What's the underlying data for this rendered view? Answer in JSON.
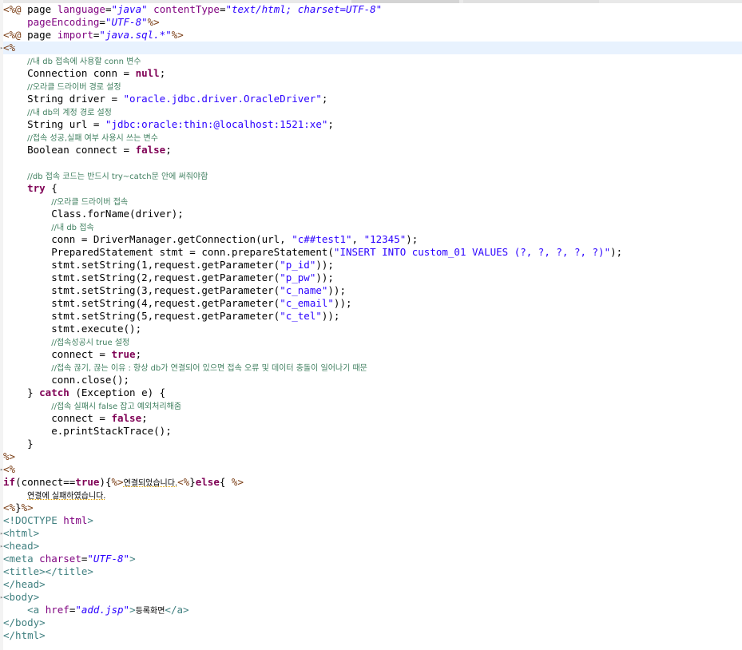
{
  "colors": {
    "background": "#ffffff",
    "current_line": "#e8f2fe",
    "directive": "#7a3d14",
    "keyword": "#7f0055",
    "string": "#2a00ff",
    "comment": "#3f7f5f",
    "tag": "#3f7f7f",
    "attribute": "#7f007f"
  },
  "editor": {
    "current_line_index": 3,
    "lines": [
      [
        [
          "dir",
          "<%@"
        ],
        [
          "t",
          " page "
        ],
        [
          "attr",
          "language"
        ],
        [
          "t",
          "="
        ],
        [
          "aval",
          "\"java\""
        ],
        [
          "t",
          " "
        ],
        [
          "attr",
          "contentType"
        ],
        [
          "t",
          "="
        ],
        [
          "aval",
          "\"text/html; charset=UTF-8\""
        ]
      ],
      [
        [
          "t",
          "    "
        ],
        [
          "attr",
          "pageEncoding"
        ],
        [
          "t",
          "="
        ],
        [
          "aval",
          "\"UTF-8\""
        ],
        [
          "dir",
          "%>"
        ]
      ],
      [
        [
          "dir",
          "<%@"
        ],
        [
          "t",
          " page "
        ],
        [
          "attr",
          "import"
        ],
        [
          "t",
          "="
        ],
        [
          "aval",
          "\"java.sql.*\""
        ],
        [
          "dir",
          "%>"
        ]
      ],
      [
        [
          "dir",
          "<%"
        ]
      ],
      [
        [
          "t",
          "    "
        ],
        [
          "com",
          "//내 db 접속에 사용할 conn 변수"
        ]
      ],
      [
        [
          "t",
          "    Connection conn = "
        ],
        [
          "kw",
          "null"
        ],
        [
          "t",
          ";"
        ]
      ],
      [
        [
          "t",
          "    "
        ],
        [
          "com",
          "//오라클 드라이버 경로 설정"
        ]
      ],
      [
        [
          "t",
          "    String driver = "
        ],
        [
          "str",
          "\"oracle.jdbc.driver.OracleDriver\""
        ],
        [
          "t",
          ";"
        ]
      ],
      [
        [
          "t",
          "    "
        ],
        [
          "com",
          "//내 db의 계정 경로 설정"
        ]
      ],
      [
        [
          "t",
          "    String url = "
        ],
        [
          "str",
          "\"jdbc:oracle:thin:@localhost:1521:xe\""
        ],
        [
          "t",
          ";"
        ]
      ],
      [
        [
          "t",
          "    "
        ],
        [
          "com",
          "//접속 성공,실패 여부 사용시 쓰는 변수"
        ]
      ],
      [
        [
          "t",
          "    Boolean connect = "
        ],
        [
          "kw",
          "false"
        ],
        [
          "t",
          ";"
        ]
      ],
      [],
      [
        [
          "t",
          "    "
        ],
        [
          "com",
          "//db 접속 코드는 반드시 try~catch문 안에 써줘야함"
        ]
      ],
      [
        [
          "t",
          "    "
        ],
        [
          "kw",
          "try"
        ],
        [
          "t",
          " {"
        ]
      ],
      [
        [
          "t",
          "        "
        ],
        [
          "com",
          "//오라클 드라이버 접속"
        ]
      ],
      [
        [
          "t",
          "        Class.forName(driver);"
        ]
      ],
      [
        [
          "t",
          "        "
        ],
        [
          "com",
          "//내 db 접속"
        ]
      ],
      [
        [
          "t",
          "        conn = DriverManager.getConnection(url, "
        ],
        [
          "str",
          "\"c##test1\""
        ],
        [
          "t",
          ", "
        ],
        [
          "str",
          "\"12345\""
        ],
        [
          "t",
          ");"
        ]
      ],
      [
        [
          "t",
          "        PreparedStatement stmt = conn.prepareStatement("
        ],
        [
          "str",
          "\"INSERT INTO custom_01 VALUES (?, ?, ?, ?, ?)\""
        ],
        [
          "t",
          ");"
        ]
      ],
      [
        [
          "t",
          "        stmt.setString(1,request.getParameter("
        ],
        [
          "str",
          "\"p_id\""
        ],
        [
          "t",
          "));"
        ]
      ],
      [
        [
          "t",
          "        stmt.setString(2,request.getParameter("
        ],
        [
          "str",
          "\"p_pw\""
        ],
        [
          "t",
          "));"
        ]
      ],
      [
        [
          "t",
          "        stmt.setString(3,request.getParameter("
        ],
        [
          "str",
          "\"c_name\""
        ],
        [
          "t",
          "));"
        ]
      ],
      [
        [
          "t",
          "        stmt.setString(4,request.getParameter("
        ],
        [
          "str",
          "\"c_email\""
        ],
        [
          "t",
          "));"
        ]
      ],
      [
        [
          "t",
          "        stmt.setString(5,request.getParameter("
        ],
        [
          "str",
          "\"c_tel\""
        ],
        [
          "t",
          "));"
        ]
      ],
      [
        [
          "t",
          "        stmt.execute();"
        ]
      ],
      [
        [
          "t",
          "        "
        ],
        [
          "com",
          "//접속성공시 true 설정"
        ]
      ],
      [
        [
          "t",
          "        connect = "
        ],
        [
          "kw",
          "true"
        ],
        [
          "t",
          ";"
        ]
      ],
      [
        [
          "t",
          "        "
        ],
        [
          "com",
          "//접속 끊기, 끊는 이유 : 항상 db가 연결되어 있으면 접속 오류 및 데이터 충돌이 일어나기 때문"
        ]
      ],
      [
        [
          "t",
          "        conn.close();"
        ]
      ],
      [
        [
          "t",
          "    } "
        ],
        [
          "kw",
          "catch"
        ],
        [
          "t",
          " (Exception e) {"
        ]
      ],
      [
        [
          "t",
          "        "
        ],
        [
          "com",
          "//접속 실패시 false 잡고 예외처리해줌"
        ]
      ],
      [
        [
          "t",
          "        connect = "
        ],
        [
          "kw",
          "false"
        ],
        [
          "t",
          ";"
        ]
      ],
      [
        [
          "t",
          "        e.printStackTrace();"
        ]
      ],
      [
        [
          "t",
          "    }"
        ]
      ],
      [
        [
          "dir",
          "%>"
        ]
      ],
      [
        [
          "dir",
          "<%"
        ]
      ],
      [
        [
          "kw",
          "if"
        ],
        [
          "t",
          "(connect=="
        ],
        [
          "kw",
          "true"
        ],
        [
          "t",
          "){"
        ],
        [
          "dir",
          "%>"
        ],
        [
          "ul",
          "연결되었습니다."
        ],
        [
          "dir",
          "<%"
        ],
        [
          "t",
          "}"
        ],
        [
          "kw",
          "else"
        ],
        [
          "t",
          "{ "
        ],
        [
          "dir",
          "%>"
        ]
      ],
      [
        [
          "t",
          "    "
        ],
        [
          "ul",
          "연결에 실패하였습니다."
        ]
      ],
      [
        [
          "dir",
          "<%"
        ],
        [
          "t",
          "}"
        ],
        [
          "dir",
          "%>"
        ]
      ],
      [
        [
          "tag",
          "<!DOCTYPE"
        ],
        [
          "t",
          " "
        ],
        [
          "attr",
          "html"
        ],
        [
          "tag",
          ">"
        ]
      ],
      [
        [
          "tag",
          "<html>"
        ]
      ],
      [
        [
          "tag",
          "<head>"
        ]
      ],
      [
        [
          "tag",
          "<meta"
        ],
        [
          "t",
          " "
        ],
        [
          "attr",
          "charset"
        ],
        [
          "t",
          "="
        ],
        [
          "aval",
          "\"UTF-8\""
        ],
        [
          "tag",
          ">"
        ]
      ],
      [
        [
          "tag",
          "<title></title>"
        ]
      ],
      [
        [
          "tag",
          "</head>"
        ]
      ],
      [
        [
          "tag",
          "<body>"
        ]
      ],
      [
        [
          "t",
          "    "
        ],
        [
          "tag",
          "<a"
        ],
        [
          "t",
          " "
        ],
        [
          "attr",
          "href"
        ],
        [
          "t",
          "="
        ],
        [
          "aval",
          "\"add.jsp\""
        ],
        [
          "tag",
          ">"
        ],
        [
          "t",
          "등록화면"
        ],
        [
          "tag",
          "</a>"
        ]
      ],
      [
        [
          "tag",
          "</body>"
        ]
      ],
      [
        [
          "tag",
          "</html>"
        ]
      ]
    ]
  }
}
